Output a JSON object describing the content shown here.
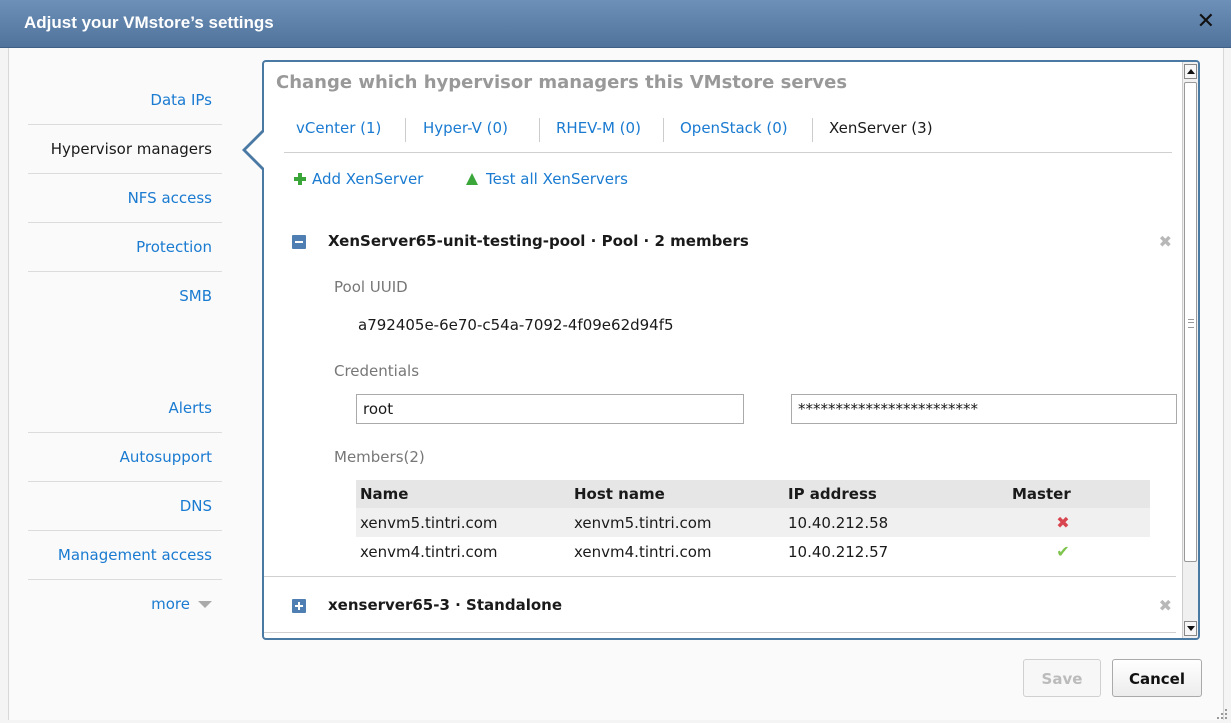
{
  "dialog": {
    "title": "Adjust your VMstore’s settings",
    "close_glyph": "✕"
  },
  "sidebar": {
    "items": [
      {
        "label": "Data IPs"
      },
      {
        "label": "Hypervisor managers",
        "active": true
      },
      {
        "label": "NFS access"
      },
      {
        "label": "Protection"
      },
      {
        "label": "SMB"
      },
      {
        "label": "Alerts"
      },
      {
        "label": "Autosupport"
      },
      {
        "label": "DNS"
      },
      {
        "label": "Management access"
      }
    ],
    "more_label": "more"
  },
  "panel": {
    "title": "Change which hypervisor managers this VMstore serves",
    "tabs": [
      {
        "label": "vCenter (1)"
      },
      {
        "label": "Hyper-V (0)"
      },
      {
        "label": "RHEV-M (0)"
      },
      {
        "label": "OpenStack (0)"
      },
      {
        "label": "XenServer (3)",
        "active": true
      }
    ],
    "actions": {
      "add_label": "Add XenServer",
      "test_label": "Test all XenServers"
    },
    "pool": {
      "title": "XenServer65-unit-testing-pool · Pool · 2 members",
      "uuid_label": "Pool UUID",
      "uuid_value": "a792405e-6e70-c54a-7092-4f09e62d94f5",
      "credentials_label": "Credentials",
      "username_value": "root",
      "password_value": "************************",
      "members_label": "Members(2)",
      "columns": [
        "Name",
        "Host name",
        "IP address",
        "Master"
      ],
      "members": [
        {
          "name": "xenvm5.tintri.com",
          "host": "xenvm5.tintri.com",
          "ip": "10.40.212.58",
          "master": false
        },
        {
          "name": "xenvm4.tintri.com",
          "host": "xenvm4.tintri.com",
          "ip": "10.40.212.57",
          "master": true
        }
      ]
    },
    "standalone": {
      "title": "xenserver65-3 · Standalone"
    },
    "remove_glyph": "✖",
    "master_false_glyph": "✖",
    "master_true_glyph": "✔"
  },
  "footer": {
    "save_label": "Save",
    "cancel_label": "Cancel"
  },
  "colors": {
    "link": "#1a7bd1",
    "titlebar": "#5b7fa8",
    "panel_border": "#4a79a3",
    "master_false": "#d9454f",
    "master_true": "#7fc44e"
  }
}
